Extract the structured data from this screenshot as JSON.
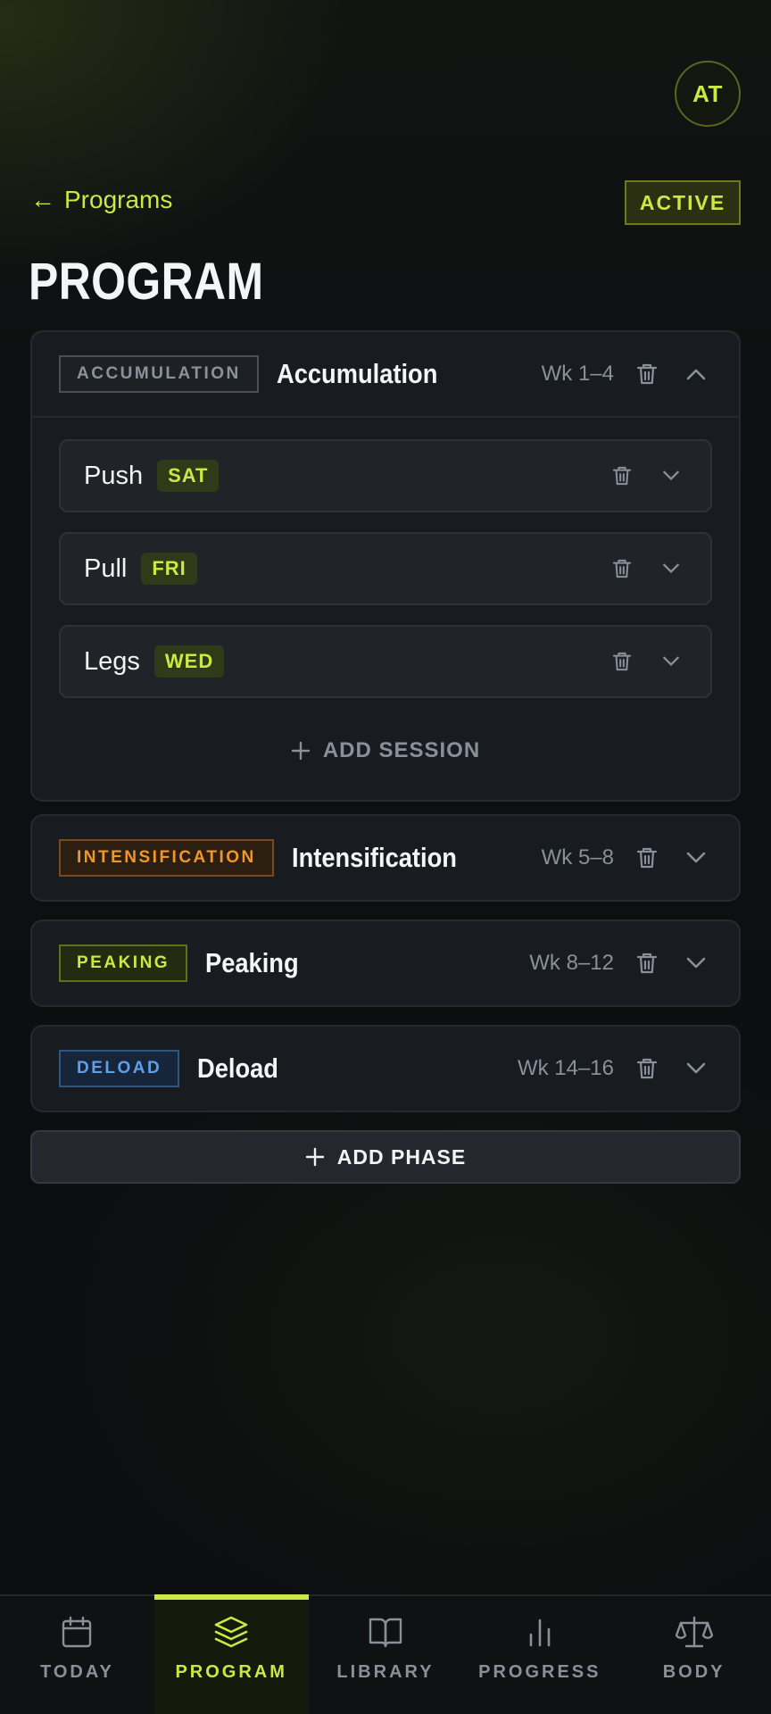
{
  "avatar": {
    "initials": "AT"
  },
  "header": {
    "back_arrow": "←",
    "back_label": "Programs",
    "status": "ACTIVE",
    "title": "PROGRAM"
  },
  "phases": [
    {
      "tag": "ACCUMULATION",
      "name": "Accumulation",
      "weeks": "Wk 1–4",
      "expanded": true,
      "sessions": [
        {
          "name": "Push",
          "day": "SAT"
        },
        {
          "name": "Pull",
          "day": "FRI"
        },
        {
          "name": "Legs",
          "day": "WED"
        }
      ],
      "add_session_label": "ADD SESSION"
    },
    {
      "tag": "INTENSIFICATION",
      "name": "Intensification",
      "weeks": "Wk 5–8",
      "expanded": false
    },
    {
      "tag": "PEAKING",
      "name": "Peaking",
      "weeks": "Wk 8–12",
      "expanded": false
    },
    {
      "tag": "DELOAD",
      "name": "Deload",
      "weeks": "Wk 14–16",
      "expanded": false
    }
  ],
  "add_phase_label": "ADD PHASE",
  "nav": [
    {
      "label": "TODAY",
      "icon": "calendar-icon",
      "active": false
    },
    {
      "label": "PROGRAM",
      "icon": "layers-icon",
      "active": true
    },
    {
      "label": "LIBRARY",
      "icon": "book-icon",
      "active": false
    },
    {
      "label": "PROGRESS",
      "icon": "bar-chart-icon",
      "active": false
    },
    {
      "label": "BODY",
      "icon": "scale-icon",
      "active": false
    }
  ],
  "colors": {
    "accent": "#cde843",
    "background": "#0d0f11",
    "card": "#181b1f",
    "intensification": "#f0972a",
    "deload": "#5fa0e8",
    "muted": "#8a9099"
  }
}
